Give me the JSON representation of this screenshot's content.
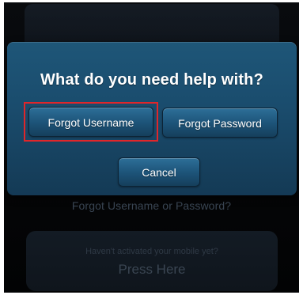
{
  "background": {
    "faded_link": "Forgot Username or Password?",
    "bottom_panel": {
      "subtitle": "Haven't activated your mobile yet?",
      "action": "Press Here"
    }
  },
  "dialog": {
    "title": "What do you need help with?",
    "buttons": {
      "forgot_username": "Forgot Username",
      "forgot_password": "Forgot Password",
      "cancel": "Cancel"
    }
  },
  "colors": {
    "dialog_bg": "#1a4c6d",
    "button_bg": "#1d5479",
    "highlight": "#e0262a",
    "screen_bg": "#050607"
  }
}
